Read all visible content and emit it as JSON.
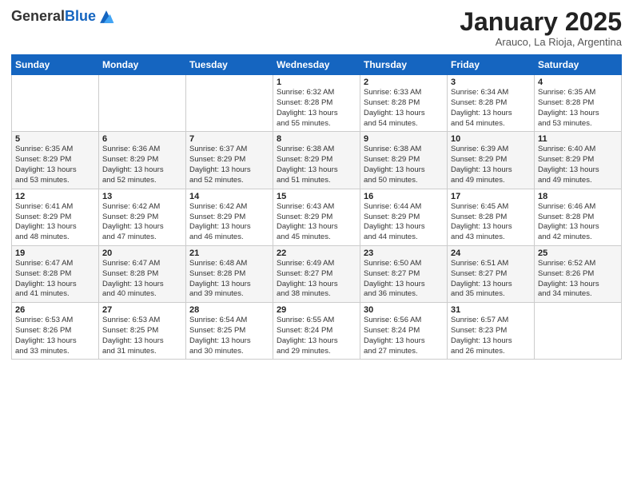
{
  "logo": {
    "general": "General",
    "blue": "Blue"
  },
  "header": {
    "title": "January 2025",
    "subtitle": "Arauco, La Rioja, Argentina"
  },
  "weekdays": [
    "Sunday",
    "Monday",
    "Tuesday",
    "Wednesday",
    "Thursday",
    "Friday",
    "Saturday"
  ],
  "weeks": [
    [
      {
        "day": "",
        "info": ""
      },
      {
        "day": "",
        "info": ""
      },
      {
        "day": "",
        "info": ""
      },
      {
        "day": "1",
        "info": "Sunrise: 6:32 AM\nSunset: 8:28 PM\nDaylight: 13 hours\nand 55 minutes."
      },
      {
        "day": "2",
        "info": "Sunrise: 6:33 AM\nSunset: 8:28 PM\nDaylight: 13 hours\nand 54 minutes."
      },
      {
        "day": "3",
        "info": "Sunrise: 6:34 AM\nSunset: 8:28 PM\nDaylight: 13 hours\nand 54 minutes."
      },
      {
        "day": "4",
        "info": "Sunrise: 6:35 AM\nSunset: 8:28 PM\nDaylight: 13 hours\nand 53 minutes."
      }
    ],
    [
      {
        "day": "5",
        "info": "Sunrise: 6:35 AM\nSunset: 8:29 PM\nDaylight: 13 hours\nand 53 minutes."
      },
      {
        "day": "6",
        "info": "Sunrise: 6:36 AM\nSunset: 8:29 PM\nDaylight: 13 hours\nand 52 minutes."
      },
      {
        "day": "7",
        "info": "Sunrise: 6:37 AM\nSunset: 8:29 PM\nDaylight: 13 hours\nand 52 minutes."
      },
      {
        "day": "8",
        "info": "Sunrise: 6:38 AM\nSunset: 8:29 PM\nDaylight: 13 hours\nand 51 minutes."
      },
      {
        "day": "9",
        "info": "Sunrise: 6:38 AM\nSunset: 8:29 PM\nDaylight: 13 hours\nand 50 minutes."
      },
      {
        "day": "10",
        "info": "Sunrise: 6:39 AM\nSunset: 8:29 PM\nDaylight: 13 hours\nand 49 minutes."
      },
      {
        "day": "11",
        "info": "Sunrise: 6:40 AM\nSunset: 8:29 PM\nDaylight: 13 hours\nand 49 minutes."
      }
    ],
    [
      {
        "day": "12",
        "info": "Sunrise: 6:41 AM\nSunset: 8:29 PM\nDaylight: 13 hours\nand 48 minutes."
      },
      {
        "day": "13",
        "info": "Sunrise: 6:42 AM\nSunset: 8:29 PM\nDaylight: 13 hours\nand 47 minutes."
      },
      {
        "day": "14",
        "info": "Sunrise: 6:42 AM\nSunset: 8:29 PM\nDaylight: 13 hours\nand 46 minutes."
      },
      {
        "day": "15",
        "info": "Sunrise: 6:43 AM\nSunset: 8:29 PM\nDaylight: 13 hours\nand 45 minutes."
      },
      {
        "day": "16",
        "info": "Sunrise: 6:44 AM\nSunset: 8:29 PM\nDaylight: 13 hours\nand 44 minutes."
      },
      {
        "day": "17",
        "info": "Sunrise: 6:45 AM\nSunset: 8:28 PM\nDaylight: 13 hours\nand 43 minutes."
      },
      {
        "day": "18",
        "info": "Sunrise: 6:46 AM\nSunset: 8:28 PM\nDaylight: 13 hours\nand 42 minutes."
      }
    ],
    [
      {
        "day": "19",
        "info": "Sunrise: 6:47 AM\nSunset: 8:28 PM\nDaylight: 13 hours\nand 41 minutes."
      },
      {
        "day": "20",
        "info": "Sunrise: 6:47 AM\nSunset: 8:28 PM\nDaylight: 13 hours\nand 40 minutes."
      },
      {
        "day": "21",
        "info": "Sunrise: 6:48 AM\nSunset: 8:28 PM\nDaylight: 13 hours\nand 39 minutes."
      },
      {
        "day": "22",
        "info": "Sunrise: 6:49 AM\nSunset: 8:27 PM\nDaylight: 13 hours\nand 38 minutes."
      },
      {
        "day": "23",
        "info": "Sunrise: 6:50 AM\nSunset: 8:27 PM\nDaylight: 13 hours\nand 36 minutes."
      },
      {
        "day": "24",
        "info": "Sunrise: 6:51 AM\nSunset: 8:27 PM\nDaylight: 13 hours\nand 35 minutes."
      },
      {
        "day": "25",
        "info": "Sunrise: 6:52 AM\nSunset: 8:26 PM\nDaylight: 13 hours\nand 34 minutes."
      }
    ],
    [
      {
        "day": "26",
        "info": "Sunrise: 6:53 AM\nSunset: 8:26 PM\nDaylight: 13 hours\nand 33 minutes."
      },
      {
        "day": "27",
        "info": "Sunrise: 6:53 AM\nSunset: 8:25 PM\nDaylight: 13 hours\nand 31 minutes."
      },
      {
        "day": "28",
        "info": "Sunrise: 6:54 AM\nSunset: 8:25 PM\nDaylight: 13 hours\nand 30 minutes."
      },
      {
        "day": "29",
        "info": "Sunrise: 6:55 AM\nSunset: 8:24 PM\nDaylight: 13 hours\nand 29 minutes."
      },
      {
        "day": "30",
        "info": "Sunrise: 6:56 AM\nSunset: 8:24 PM\nDaylight: 13 hours\nand 27 minutes."
      },
      {
        "day": "31",
        "info": "Sunrise: 6:57 AM\nSunset: 8:23 PM\nDaylight: 13 hours\nand 26 minutes."
      },
      {
        "day": "",
        "info": ""
      }
    ]
  ]
}
